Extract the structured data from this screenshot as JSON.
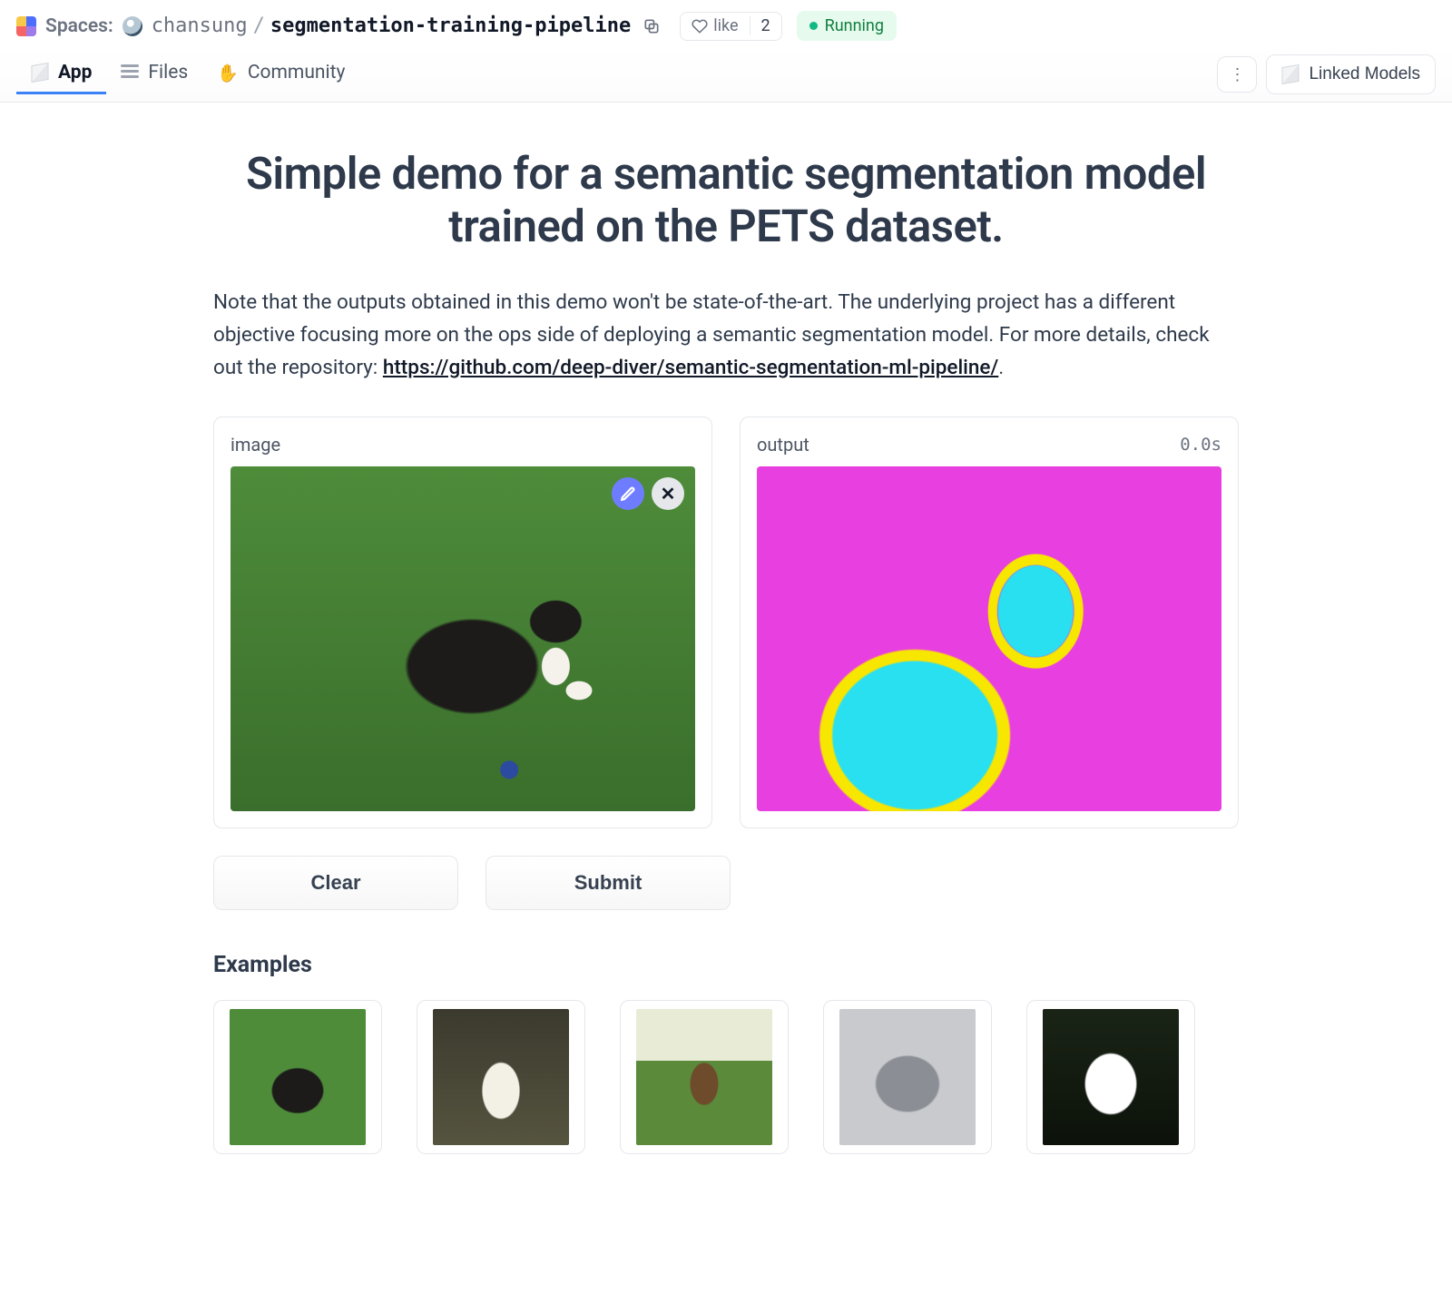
{
  "header": {
    "platform_label": "Spaces:",
    "owner": "chansung",
    "repo": "segmentation-training-pipeline",
    "like_label": "like",
    "like_count": "2",
    "status": "Running"
  },
  "tabs": {
    "app": "App",
    "files": "Files",
    "community": "Community",
    "linked_models": "Linked Models"
  },
  "app": {
    "title": "Simple demo for a semantic segmentation model trained on the PETS dataset.",
    "desc_prefix": "Note that the outputs obtained in this demo won't be state-of-the-art. The underlying project has a different objective focusing more on the ops side of deploying a semantic segmentation model. For more details, check out the repository: ",
    "desc_link": "https://github.com/deep-diver/semantic-segmentation-ml-pipeline/",
    "desc_suffix": ".",
    "input_label": "image",
    "output_label": "output",
    "output_timing": "0.0s",
    "clear_btn": "Clear",
    "submit_btn": "Submit",
    "examples_label": "Examples"
  }
}
